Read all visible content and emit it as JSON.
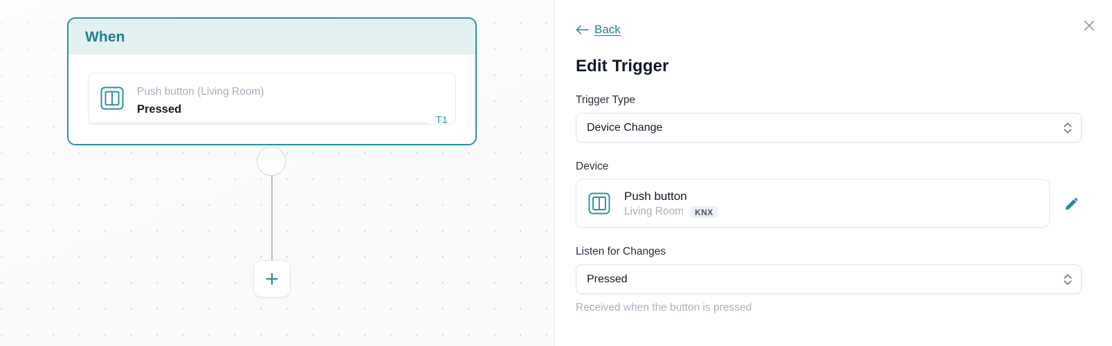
{
  "canvas": {
    "trigger_card": {
      "header_title": "When",
      "device": {
        "subtitle": "Push button (Living Room)",
        "title": "Pressed",
        "icon": "push-button-icon",
        "tag": "T1"
      }
    },
    "add_node": {
      "icon": "plus-icon",
      "label": "+"
    },
    "handle": {
      "icon": "connector-handle"
    }
  },
  "panel": {
    "close": {
      "icon": "close-icon"
    },
    "back": {
      "label": "Back",
      "icon": "arrow-left-icon"
    },
    "title": "Edit Trigger",
    "trigger_type": {
      "label": "Trigger Type",
      "value": "Device Change",
      "options": [
        "Device Change"
      ],
      "icon": "chevron-updown-icon"
    },
    "device": {
      "label": "Device",
      "name": "Push button",
      "room": "Living Room",
      "protocol": "KNX",
      "icon": "push-button-icon",
      "edit_icon": "pencil-icon"
    },
    "listen": {
      "label": "Listen for Changes",
      "value": "Pressed",
      "options": [
        "Pressed"
      ],
      "help": "Received when the button is pressed",
      "icon": "chevron-updown-icon"
    }
  },
  "colors": {
    "accent_teal": "#2d8f9b",
    "header_mint": "#e3f1f0",
    "link_teal": "#21808d",
    "muted": "#a7b0bd",
    "canvas_bg": "#fafafa"
  }
}
